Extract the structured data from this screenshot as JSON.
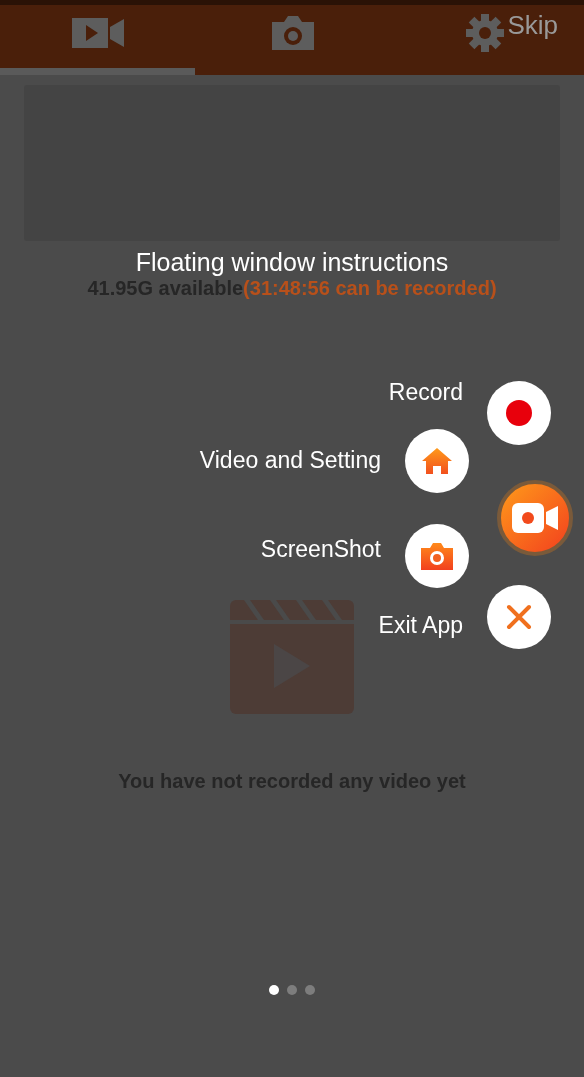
{
  "tabs": [
    {
      "kind": "video",
      "selected": true
    },
    {
      "kind": "camera",
      "selected": false
    },
    {
      "kind": "settings",
      "selected": false
    }
  ],
  "storage": {
    "available": "41.95G available",
    "recordable": "(31:48:56 can be recorded)"
  },
  "empty_message": "You have not recorded any video yet",
  "overlay": {
    "title": "Floating window instructions",
    "skip": "Skip",
    "items": [
      {
        "label": "Record",
        "kind": "record"
      },
      {
        "label": "Video and Setting",
        "kind": "home"
      },
      {
        "label": "ScreenShot",
        "kind": "screenshot"
      },
      {
        "label": "Exit App",
        "kind": "exit"
      }
    ],
    "dots": [
      {
        "selected": true
      },
      {
        "selected": false
      },
      {
        "selected": false
      }
    ]
  }
}
